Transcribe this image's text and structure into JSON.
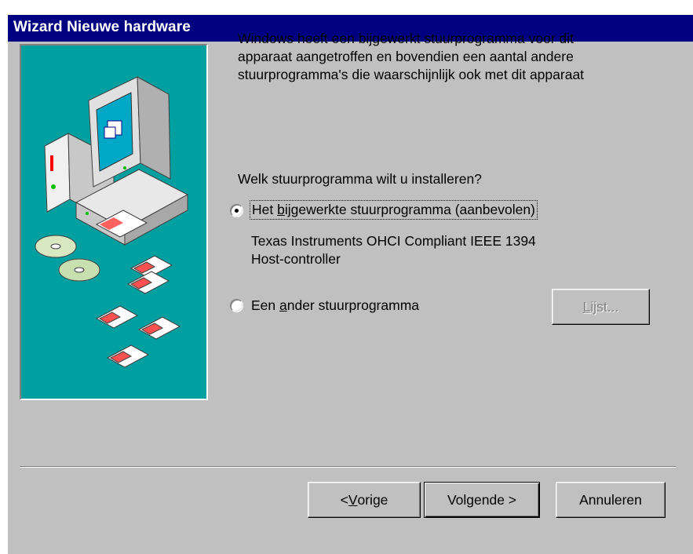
{
  "window": {
    "title": "Wizard Nieuwe hardware"
  },
  "content": {
    "description": "Windows heeft een bijgewerkt stuurprogramma voor dit\napparaat aangetroffen en bovendien een aantal andere\nstuurprogramma's die waarschijnlijk ook met dit apparaat",
    "question": "Welk stuurprogramma wilt u installeren?",
    "option_updated": {
      "before": "Het ",
      "accel": "b",
      "after": "ijgewerkte stuurprogramma (aanbevolen)",
      "selected": true
    },
    "driver_name": "Texas Instruments OHCI Compliant IEEE 1394\nHost-controller",
    "option_other": {
      "before": "Een ",
      "accel": "a",
      "after": "nder stuurprogramma",
      "selected": false
    },
    "list_button": {
      "accel": "L",
      "after": "ijst...",
      "enabled": false
    }
  },
  "footer": {
    "back_button": {
      "before": "< ",
      "accel": "V",
      "after": "orige"
    },
    "next_button": {
      "label": "Volgende >"
    },
    "cancel_button": {
      "label": "Annuleren"
    }
  },
  "icons": {
    "illustration": "computer-cds-floppies-illustration",
    "selected_radio": "radio-selected-icon",
    "unselected_radio": "radio-unselected-icon"
  },
  "colors": {
    "titlebar": "#000080",
    "dialog_face": "#c0c0c0",
    "illustration_bg": "#00a0a0"
  }
}
